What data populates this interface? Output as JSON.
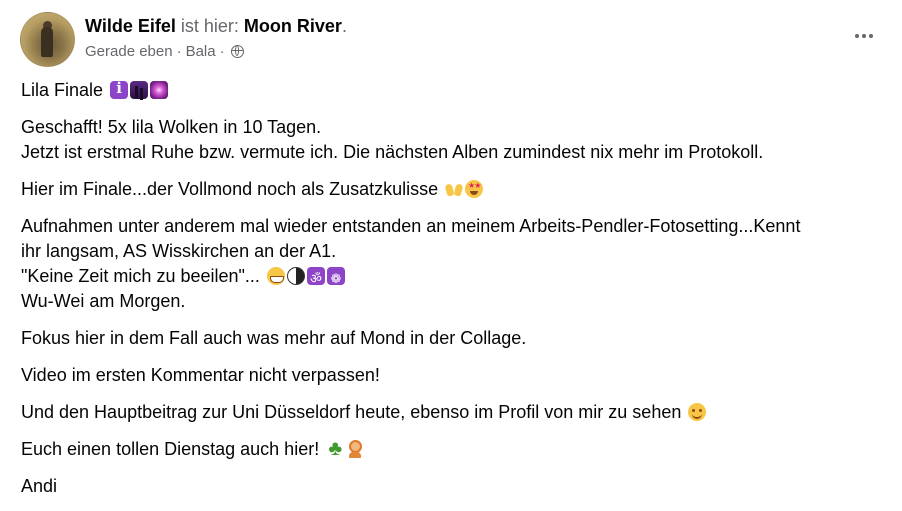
{
  "post": {
    "author": "Wilde Eifel",
    "status_prefix": "ist hier:",
    "location": "Moon River",
    "status_suffix": ".",
    "timestamp": "Gerade eben",
    "separator": "·",
    "place": "Bala",
    "audience_icon": "globe-icon",
    "more_icon": "more-options-icon"
  },
  "content": {
    "p1": "Lila Finale",
    "p2_l1": "Geschafft! 5x lila Wolken in 10 Tagen.",
    "p2_l2": "Jetzt ist erstmal Ruhe bzw. vermute ich. Die nächsten Alben zumindest nix mehr im Protokoll.",
    "p3": "Hier im Finale...der Vollmond noch als Zusatzkulisse",
    "p4_l1": "Aufnahmen unter anderem mal wieder entstanden an meinem Arbeits-Pendler-Fotosetting...Kennt",
    "p4_l2": "ihr langsam, AS Wisskirchen an der A1.",
    "p4_l3": "\"Keine Zeit mich zu beeilen\"...",
    "p4_l4": "Wu-Wei am Morgen.",
    "p5": "Fokus hier in dem Fall auch was mehr auf Mond in der Collage.",
    "p6": "Video im ersten Kommentar nicht verpassen!",
    "p7": "Und den Hauptbeitrag zur Uni Düsseldorf heute, ebenso im Profil von mir zu sehen",
    "p8": "Euch einen tollen Dienstag auch hier!",
    "p9": "Andi"
  },
  "emojis": {
    "p1": [
      "information-emoji",
      "night-scene-emoji",
      "galaxy-emoji"
    ],
    "p3": [
      "raising-hands-emoji",
      "star-struck-emoji"
    ],
    "p4": [
      "grinning-emoji",
      "yin-yang-emoji",
      "om-emoji",
      "wheel-of-dharma-emoji"
    ],
    "p7": [
      "smiling-face-emoji"
    ],
    "p8": [
      "four-leaf-clover-emoji",
      "person-raising-hand-emoji"
    ]
  },
  "colors": {
    "text": "#050505",
    "muted": "#65676b",
    "accent_purple": "#8e44c8"
  }
}
